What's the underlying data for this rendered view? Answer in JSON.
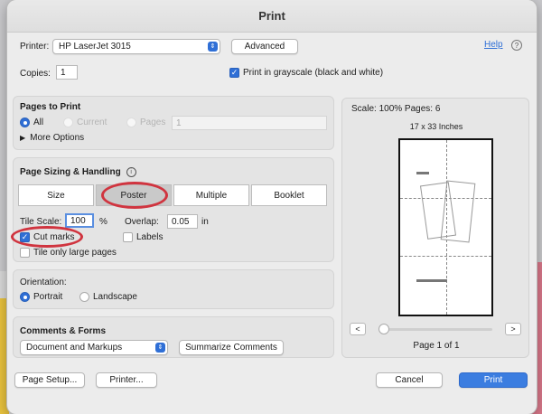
{
  "window": {
    "title": "Print"
  },
  "printer": {
    "label": "Printer:",
    "value": "HP LaserJet 3015",
    "advanced": "Advanced",
    "help": "Help"
  },
  "copies": {
    "label": "Copies:",
    "value": "1"
  },
  "grayscale": {
    "label": "Print in grayscale (black and white)",
    "checked": true
  },
  "pages": {
    "heading": "Pages to Print",
    "all": "All",
    "current": "Current",
    "pages": "Pages",
    "pages_value": "1",
    "more_options": "More Options"
  },
  "sizing": {
    "heading": "Page Sizing & Handling",
    "tabs": [
      "Size",
      "Poster",
      "Multiple",
      "Booklet"
    ],
    "active_tab": "Poster",
    "tile_scale_label": "Tile Scale:",
    "tile_scale_value": "100",
    "percent": "%",
    "overlap_label": "Overlap:",
    "overlap_value": "0.05",
    "overlap_unit": "in",
    "cut_marks": "Cut marks",
    "labels": "Labels",
    "tile_only_large": "Tile only large pages"
  },
  "orientation": {
    "heading": "Orientation:",
    "portrait": "Portrait",
    "landscape": "Landscape"
  },
  "comments": {
    "heading": "Comments & Forms",
    "value": "Document and Markups",
    "summarize": "Summarize Comments"
  },
  "preview": {
    "scale": "Scale: 100% Pages: 6",
    "size": "17 x 33 Inches",
    "page_indicator": "Page 1 of 1",
    "prev": "<",
    "next": ">"
  },
  "footer": {
    "page_setup": "Page Setup...",
    "printer": "Printer...",
    "cancel": "Cancel",
    "print": "Print"
  },
  "colors": {
    "accent": "#2f6fd6",
    "highlight": "#d0343f"
  }
}
